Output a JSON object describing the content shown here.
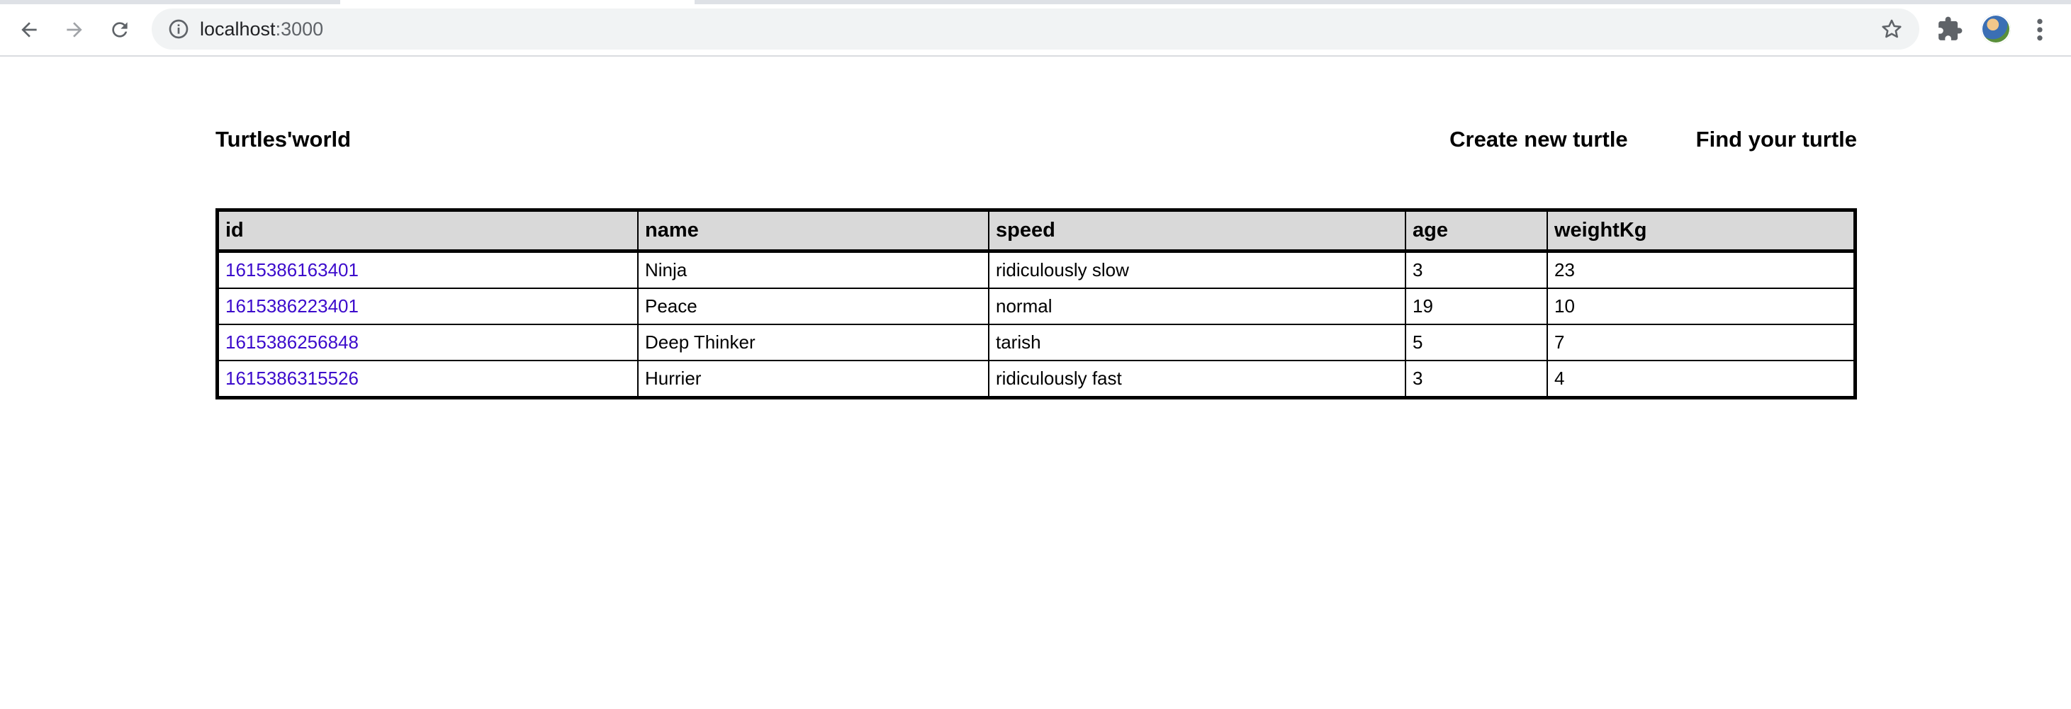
{
  "browser": {
    "url_host": "localhost",
    "url_port": ":3000"
  },
  "header": {
    "brand": "Turtles'world",
    "nav": {
      "create": "Create new turtle",
      "find": "Find your turtle"
    }
  },
  "table": {
    "columns": [
      "id",
      "name",
      "speed",
      "age",
      "weightKg"
    ],
    "rows": [
      {
        "id": "1615386163401",
        "name": "Ninja",
        "speed": "ridiculously slow",
        "age": "3",
        "weightKg": "23"
      },
      {
        "id": "1615386223401",
        "name": "Peace",
        "speed": "normal",
        "age": "19",
        "weightKg": "10"
      },
      {
        "id": "1615386256848",
        "name": "Deep Thinker",
        "speed": "tarish",
        "age": "5",
        "weightKg": "7"
      },
      {
        "id": "1615386315526",
        "name": "Hurrier",
        "speed": "ridiculously fast",
        "age": "3",
        "weightKg": "4"
      }
    ]
  },
  "icons": {
    "back": "back-arrow-icon",
    "forward": "forward-arrow-icon",
    "reload": "reload-icon",
    "info": "info-icon",
    "star": "star-icon",
    "extensions": "puzzle-icon",
    "menu": "kebab-menu-icon"
  },
  "colors": {
    "link": "#3c0bcc",
    "header_bg": "#d9d9d9"
  }
}
